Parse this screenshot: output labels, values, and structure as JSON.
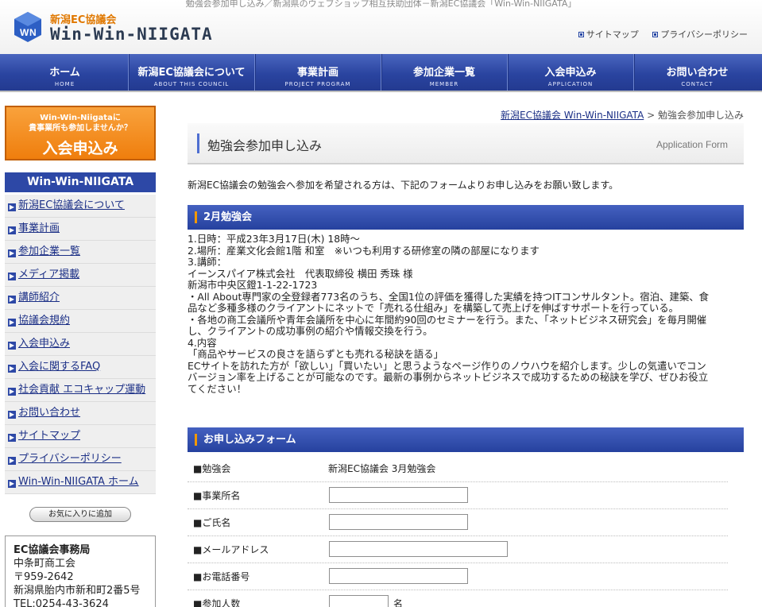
{
  "header": {
    "topline": "勉強会参加申し込み／新潟県のウェブショップ相互扶助団体－新潟EC協議会「Win-Win-NIIGATA」",
    "logo_small": "新潟EC協議会",
    "logo_big": "Win-Win-NIIGATA",
    "links": [
      "サイトマップ",
      "プライバシーポリシー"
    ]
  },
  "nav": [
    {
      "jp": "ホーム",
      "en": "HOME"
    },
    {
      "jp": "新潟EC協議会について",
      "en": "ABOUT THIS COUNCIL"
    },
    {
      "jp": "事業計画",
      "en": "PROJECT PROGRAM"
    },
    {
      "jp": "参加企業一覧",
      "en": "MEMBER"
    },
    {
      "jp": "入会申込み",
      "en": "APPLICATION"
    },
    {
      "jp": "お問い合わせ",
      "en": "CONTACT"
    }
  ],
  "sidebar": {
    "banner_sub1": "Win-Win-Niigataに",
    "banner_sub2": "貴事業所も参加しませんか？",
    "banner_main": "入会申込み",
    "title": "Win-Win-NIIGATA",
    "items": [
      "新潟EC協議会について",
      "事業計画",
      "参加企業一覧",
      "メディア掲載",
      "講師紹介",
      "協議会規約",
      "入会申込み",
      "入会に関するFAQ",
      "社会貢献 エコキャップ運動",
      "お問い合わせ",
      "サイトマップ",
      "プライバシーポリシー",
      "Win-Win-NIIGATA ホーム"
    ],
    "fav_button": "お気に入りに追加",
    "office": {
      "name": "EC協議会事務局",
      "line1": "中条町商工会",
      "line2": "〒959-2642",
      "line3": "新潟県胎内市新和町2番5号",
      "line4": "TEL:0254-43-3624"
    }
  },
  "breadcrumb": {
    "link": "新潟EC協議会 Win-Win-NIIGATA",
    "sep": " > ",
    "current": "勉強会参加申し込み"
  },
  "page": {
    "title": "勉強会参加申し込み",
    "title_en": "Application Form",
    "intro": "新潟EC協議会の勉強会へ参加を希望される方は、下記のフォームよりお申し込みをお願い致します。"
  },
  "event": {
    "heading": "2月勉強会",
    "lines": [
      "1.日時：平成23年3月17日(木) 18時～",
      "2.場所：産業文化会館1階 和室　※いつも利用する研修室の隣の部屋になります",
      "3.講師：",
      "イーンスパイア株式会社　代表取締役 横田 秀珠 様",
      "新潟市中央区鐙1-1-22-1723",
      "・All About専門家の全登録者773名のうち、全国1位の評価を獲得した実績を持つITコンサルタント。宿泊、建築、食",
      "品など多種多様のクライアントにネットで「売れる仕組み」を構築して売上げを伸ばすサポートを行っている。",
      "・各地の商工会議所や青年会議所を中心に年間約90回のセミナーを行う。また、「ネットビジネス研究会」を毎月開催",
      "し、クライアントの成功事例の紹介や情報交換を行う。",
      "4.内容",
      "「商品やサービスの良さを語らずとも売れる秘訣を語る」",
      "ECサイトを訪れた方が「欲しい」「買いたい」と思うようなページ作りのノウハウを紹介します。少しの気遣いでコン",
      "バージョン率を上げることが可能なのです。最新の事例からネットビジネスで成功するための秘訣を学び、ぜひお役立",
      "てください！"
    ]
  },
  "form": {
    "heading": "お申し込みフォーム",
    "study_label": "■勉強会",
    "study_value": "新潟EC協議会 3月勉強会",
    "office_label": "■事業所名",
    "name_label": "■ご氏名",
    "email_label": "■メールアドレス",
    "phone_label": "■お電話番号",
    "count_label": "■参加人数",
    "count_unit": "名"
  },
  "colors": {
    "nav": "#2a44a0",
    "accent": "#f39800",
    "banner": "#ef7e0d"
  }
}
